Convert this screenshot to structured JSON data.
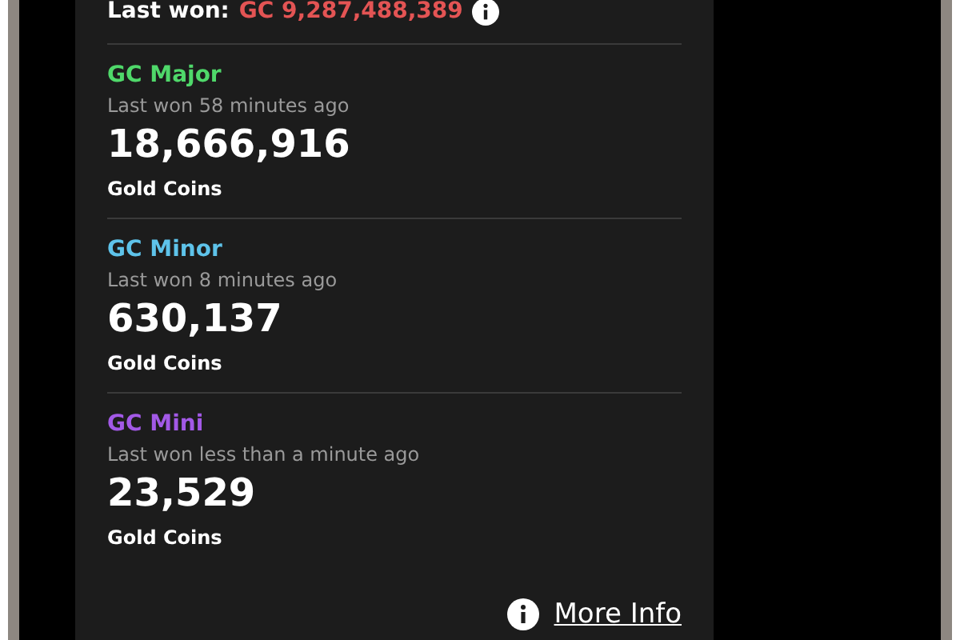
{
  "last_won": {
    "label": "Last won:",
    "value": "GC 9,287,488,389"
  },
  "tiers": [
    {
      "name": "GC Major",
      "color": "#4fd86a",
      "subtitle": "Last won 58 minutes ago",
      "amount": "18,666,916",
      "unit": "Gold Coins"
    },
    {
      "name": "GC Minor",
      "color": "#5ec3ea",
      "subtitle": "Last won 8 minutes ago",
      "amount": "630,137",
      "unit": "Gold Coins"
    },
    {
      "name": "GC Mini",
      "color": "#a259e6",
      "subtitle": "Last won less than a minute ago",
      "amount": "23,529",
      "unit": "Gold Coins"
    }
  ],
  "more_info": {
    "label": "More Info"
  }
}
